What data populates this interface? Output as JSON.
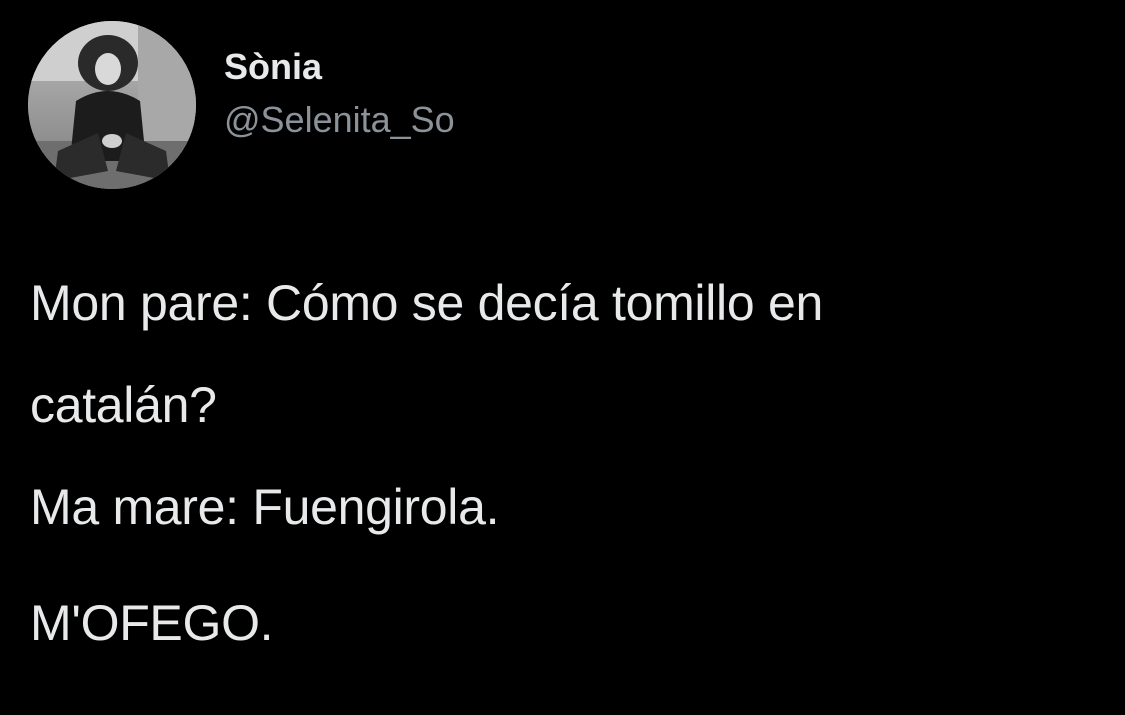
{
  "author": {
    "display_name": "Sònia",
    "handle": "@Selenita_So",
    "avatar_icon": "profile-photo"
  },
  "tweet": {
    "lines": [
      "Mon pare: Cómo se decía tomillo en",
      "catalán?",
      "Ma mare: Fuengirola.",
      "M'OFEGO."
    ]
  },
  "colors": {
    "background": "#000000",
    "text": "#e7e9ea",
    "secondary_text": "#8b9299"
  }
}
